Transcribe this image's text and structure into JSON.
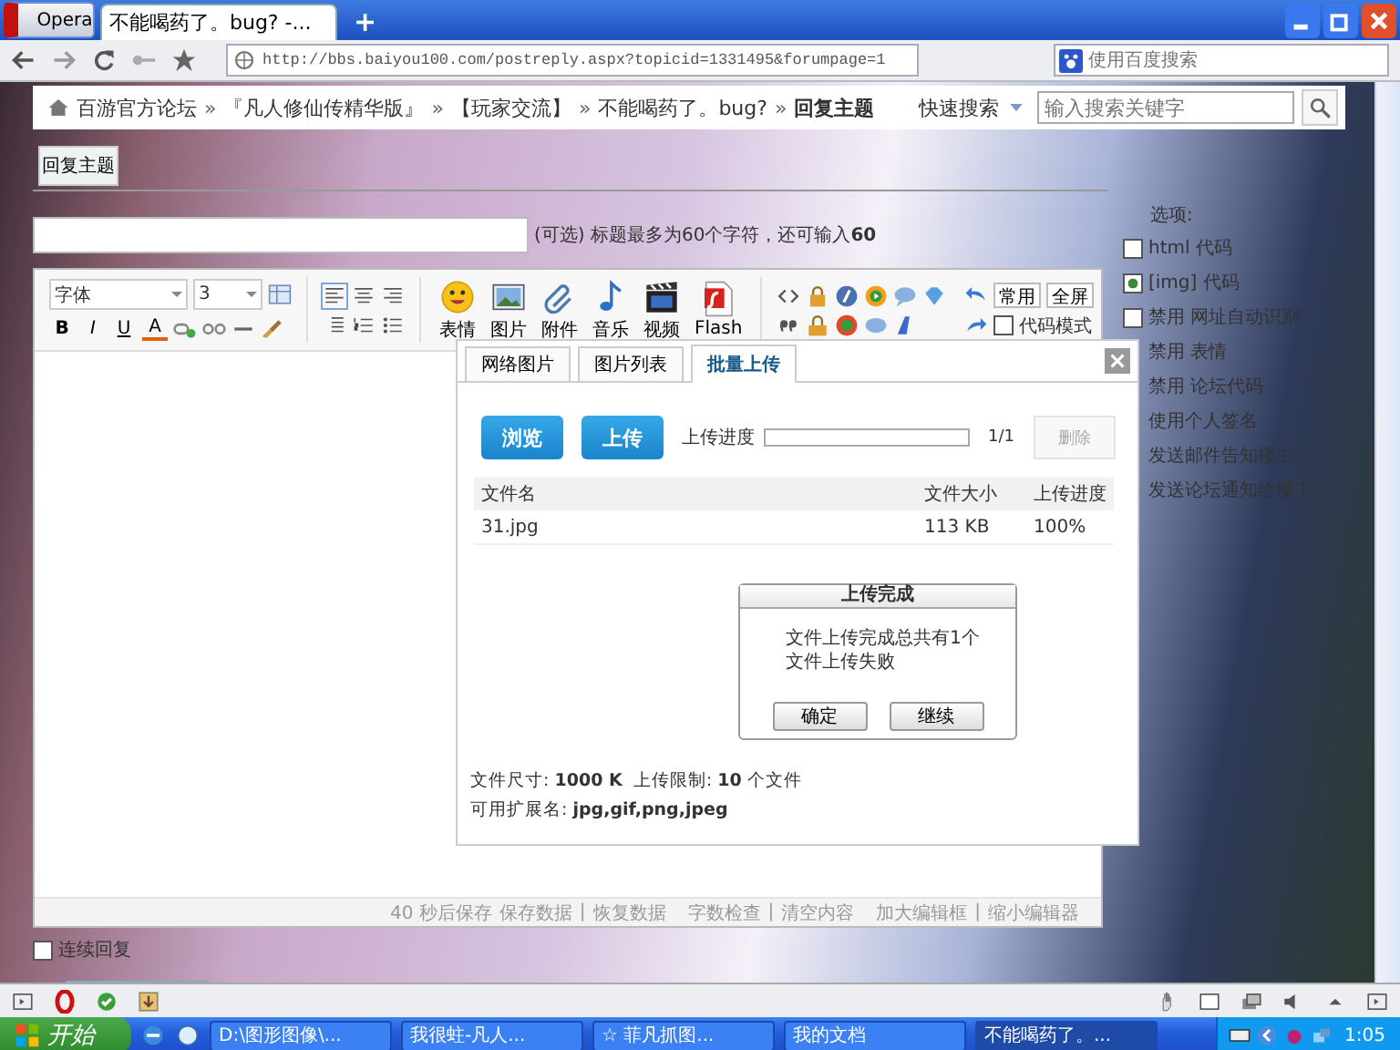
{
  "browser": {
    "menu_button": "Opera",
    "tabs": [
      {
        "title": "不能喝药了。bug? -...",
        "selected": true
      }
    ],
    "new_tab": "+",
    "address": "http://bbs.baiyou100.com/postreply.aspx?topicid=1331495&forumpage=1",
    "search_placeholder": "使用百度搜索"
  },
  "header": {
    "breadcrumb": [
      {
        "kind": "link",
        "text": "百游官方论坛"
      },
      {
        "kind": "sep",
        "text": "»"
      },
      {
        "kind": "link",
        "text": "『凡人修仙传精华版』"
      },
      {
        "kind": "sep",
        "text": "»"
      },
      {
        "kind": "link",
        "text": "【玩家交流】"
      },
      {
        "kind": "sep",
        "text": "»"
      },
      {
        "kind": "link",
        "text": "不能喝药了。bug?"
      },
      {
        "kind": "sep",
        "text": "»"
      },
      {
        "kind": "current",
        "text": "回复主题"
      }
    ],
    "quick_search": "快速搜索",
    "search_placeholder": "输入搜索关键字"
  },
  "reply_tab": "回复主题",
  "title_field": {
    "hint": "(可选) 标题最多为60个字符，还可输入**60**"
  },
  "editor": {
    "font": "字体",
    "size": "3",
    "format_buttons": [
      "B",
      "I",
      "U",
      "A"
    ],
    "big_tools": [
      {
        "kind": "smiley",
        "label": "表情"
      },
      {
        "kind": "picture",
        "label": "图片"
      },
      {
        "kind": "clip",
        "label": "附件"
      },
      {
        "kind": "note",
        "label": "音乐"
      },
      {
        "kind": "clapper",
        "label": "视频"
      },
      {
        "kind": "flash",
        "label": "Flash"
      }
    ],
    "mode_buttons": [
      "常用",
      "全屏"
    ],
    "code_mode": {
      "label": "代码模式",
      "checked": false
    },
    "status_items": [
      {
        "kind": "text",
        "text": "40 秒后保存"
      },
      {
        "kind": "link",
        "text": "保存数据"
      },
      {
        "kind": "sep",
        "text": "|"
      },
      {
        "kind": "link",
        "text": "恢复数据"
      },
      {
        "kind": "gap",
        "text": "字数检查"
      },
      {
        "kind": "sep",
        "text": "|"
      },
      {
        "kind": "link",
        "text": "清空内容"
      },
      {
        "kind": "gap",
        "text": "加大编辑框"
      },
      {
        "kind": "sep",
        "text": "|"
      },
      {
        "kind": "link",
        "text": "缩小编辑器"
      }
    ]
  },
  "options": {
    "heading": "选项:",
    "items": [
      {
        "label": "html 代码",
        "checked": false
      },
      {
        "label": "[img] 代码",
        "checked": true
      },
      {
        "label": "禁用 网址自动识别",
        "checked": false
      },
      {
        "label": "禁用 表情"
      },
      {
        "label": "禁用 论坛代码"
      },
      {
        "label": "使用个人签名"
      },
      {
        "label": "发送邮件告知楼主"
      },
      {
        "label": "发送论坛通知给楼主"
      }
    ]
  },
  "dialog": {
    "tabs": [
      {
        "label": "网络图片",
        "selected": false
      },
      {
        "label": "图片列表",
        "selected": false
      },
      {
        "label": "批量上传",
        "selected": true
      }
    ],
    "browse": "浏览",
    "upload": "上传",
    "progress_label": "上传进度",
    "progress": {
      "level": 0,
      "reading": "1/1"
    },
    "delete": {
      "label": "删除",
      "disabled": true
    },
    "columns": [
      "文件名",
      "文件大小",
      "上传进度"
    ],
    "rows": [
      [
        "31.jpg",
        "113 KB",
        "100%"
      ]
    ],
    "footer": [
      "文件尺寸: **1000 K**  上传限制: **10** 个文件",
      "可用扩展名: **jpg,gif,png,jpeg**"
    ]
  },
  "alert": {
    "title": "上传完成",
    "message": "文件上传完成总共有1个文件上传失败",
    "buttons": [
      "确定",
      "继续"
    ]
  },
  "continue_reply": {
    "label": "连续回复",
    "checked": false
  },
  "taskbar": {
    "start": "开始",
    "tasks": [
      {
        "label": "D:\\图形图像\\...",
        "selected": false
      },
      {
        "label": "我很蛀-凡人...",
        "selected": false
      },
      {
        "label": "☆ 菲凡抓图...",
        "selected": false
      },
      {
        "label": "我的文档",
        "selected": false
      },
      {
        "label": "不能喝药了。...",
        "selected": true
      }
    ],
    "clock": "1:05"
  }
}
